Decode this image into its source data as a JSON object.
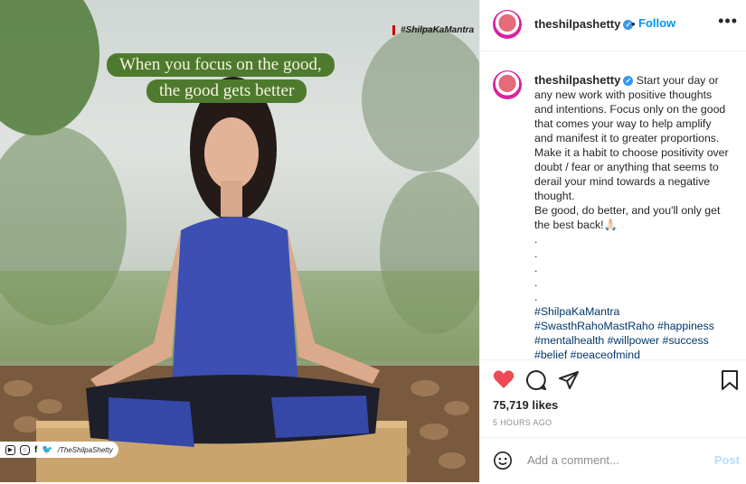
{
  "photo": {
    "quote_line1": "When you focus on the good,",
    "quote_line2": "the good gets better",
    "hashtag_stamp": "#ShilpaKaMantra",
    "social_handle": "/TheShilpaShetty"
  },
  "header": {
    "username": "theshilpashetty",
    "separator": "•",
    "follow_label": "Follow",
    "more_label": "•••"
  },
  "caption": {
    "username": "theshilpashetty",
    "text": "Start your day or any new work with positive thoughts and intentions. Focus only on the good that comes your way to help amplify and manifest it to greater proportions. Make it a habit to choose positivity over doubt / fear or anything that seems to derail your mind towards a negative thought.\nBe good, do better, and you'll only get the best back!🙏🏻\n.\n.\n.\n.\n.",
    "hashtags": "#ShilpaKaMantra\n#SwasthRahoMastRaho #happiness\n#mentalhealth #willpower #success\n#belief #peaceofmind"
  },
  "stats": {
    "likes": "75,719 likes",
    "time": "5 HOURS AGO"
  },
  "comment_box": {
    "placeholder": "Add a comment...",
    "post_label": "Post"
  },
  "colors": {
    "like_red": "#ed4956",
    "follow_blue": "#0095f6",
    "quote_green": "#4e7a2e"
  },
  "icons": [
    "heart-icon",
    "comment-icon",
    "share-icon",
    "bookmark-icon",
    "emoji-icon",
    "verified-icon",
    "more-icon"
  ]
}
